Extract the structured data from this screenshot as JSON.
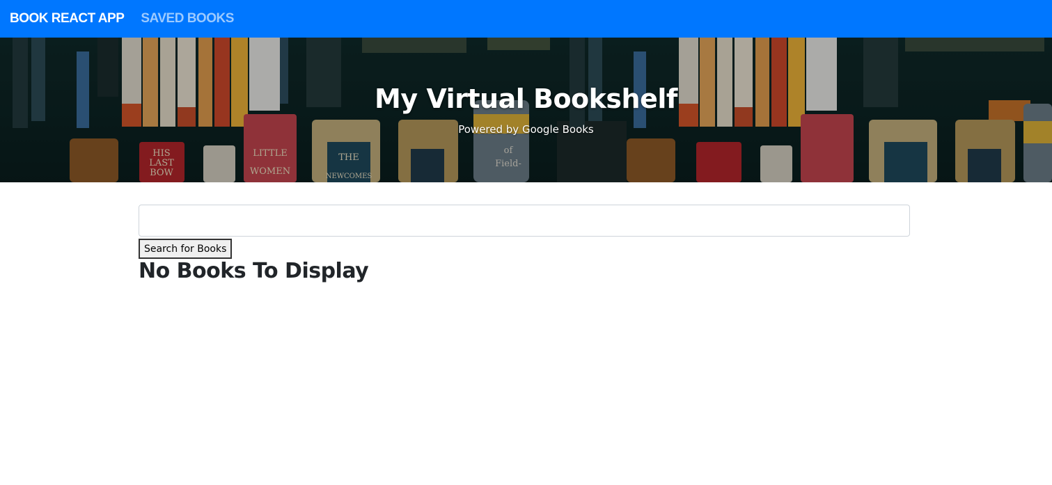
{
  "navbar": {
    "brand_label": "BOOK REACT APP",
    "saved_books_label": "SAVED BOOKS"
  },
  "hero": {
    "title": "My Virtual Bookshelf",
    "subtitle": "Powered by Google Books",
    "spine_texts": [
      "HIS",
      "LAST",
      "BOW",
      "LITTLE",
      "WOMEN",
      "THE",
      "NEWCOMES",
      "of",
      "Field-"
    ]
  },
  "search": {
    "input_value": "",
    "button_label": "Search for Books"
  },
  "results": {
    "empty_message": "No Books To Display"
  },
  "colors": {
    "navbar": "#0077ff",
    "nav_link_muted": "#9ccaff",
    "heading_text": "#212529"
  }
}
